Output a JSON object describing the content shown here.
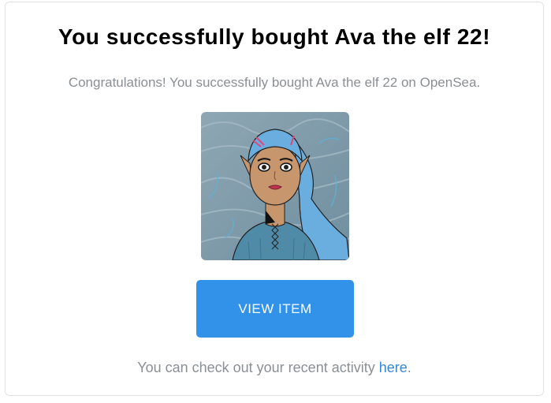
{
  "email": {
    "title": "You successfully bought Ava the elf 22!",
    "subtitle": "Congratulations! You successfully bought Ava the elf 22 on OpenSea.",
    "button_label": "VIEW ITEM",
    "footer_prefix": "You can check out your recent activity ",
    "footer_link": "here",
    "footer_suffix": "."
  },
  "colors": {
    "button": "#3291e9",
    "link": "#3a86d6",
    "muted_text": "#8a8f94"
  }
}
